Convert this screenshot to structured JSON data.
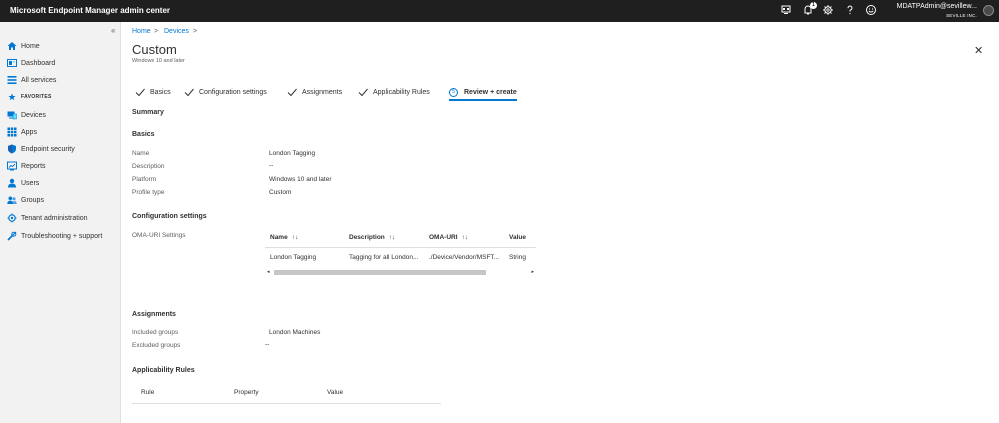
{
  "header": {
    "app_title": "Microsoft Endpoint Manager admin center",
    "notification_count": "1",
    "user_name": "MDATPAdmin@sevillew...",
    "user_org": "SEVILLE INC."
  },
  "sidebar": {
    "collapse_glyph": "«",
    "items": [
      {
        "label": "Home",
        "icon": "home-icon"
      },
      {
        "label": "Dashboard",
        "icon": "dashboard-icon"
      },
      {
        "label": "All services",
        "icon": "all-services-icon"
      },
      {
        "label": "FAVORITES",
        "icon": "star-icon"
      },
      {
        "label": "Devices",
        "icon": "devices-icon"
      },
      {
        "label": "Apps",
        "icon": "apps-icon"
      },
      {
        "label": "Endpoint security",
        "icon": "shield-icon"
      },
      {
        "label": "Reports",
        "icon": "reports-icon"
      },
      {
        "label": "Users",
        "icon": "user-icon"
      },
      {
        "label": "Groups",
        "icon": "groups-icon"
      },
      {
        "label": "Tenant administration",
        "icon": "tenant-icon"
      },
      {
        "label": "Troubleshooting + support",
        "icon": "wrench-icon"
      }
    ]
  },
  "breadcrumb": {
    "home": "Home",
    "devices": "Devices",
    "sep": ">"
  },
  "page": {
    "title": "Custom",
    "subtitle": "Windows 10 and later",
    "close": "✕"
  },
  "steps": [
    {
      "label": "Basics",
      "state": "done"
    },
    {
      "label": "Configuration settings",
      "state": "done"
    },
    {
      "label": "Assignments",
      "state": "done"
    },
    {
      "label": "Applicability Rules",
      "state": "done"
    },
    {
      "label": "Review + create",
      "state": "active",
      "number": "5"
    }
  ],
  "summary": {
    "heading": "Summary",
    "basics": {
      "heading": "Basics",
      "rows": [
        {
          "label": "Name",
          "value": "London Tagging"
        },
        {
          "label": "Description",
          "value": "--"
        },
        {
          "label": "Platform",
          "value": "Windows 10 and later"
        },
        {
          "label": "Profile type",
          "value": "Custom"
        }
      ]
    },
    "configuration": {
      "heading": "Configuration settings",
      "oma_label": "OMA-URI Settings",
      "columns": [
        "Name",
        "Description",
        "OMA-URI",
        "Value"
      ],
      "sort_glyph": "↑↓",
      "rows": [
        {
          "name": "London Tagging",
          "description": "Tagging for all London...",
          "oma_uri": "./Device/Vendor/MSFT...",
          "value": "String"
        }
      ],
      "scroll_left": "◂",
      "scroll_right": "▸"
    },
    "assignments": {
      "heading": "Assignments",
      "rows": [
        {
          "label": "Included groups",
          "value": "London Machines"
        },
        {
          "label": "Excluded groups",
          "value": "--"
        }
      ]
    },
    "applicability": {
      "heading": "Applicability Rules",
      "columns": [
        "Rule",
        "Property",
        "Value"
      ]
    }
  },
  "colors": {
    "accent": "#0078d4",
    "topbar": "#1f1f1f",
    "sidebar": "#f2f2f2"
  }
}
